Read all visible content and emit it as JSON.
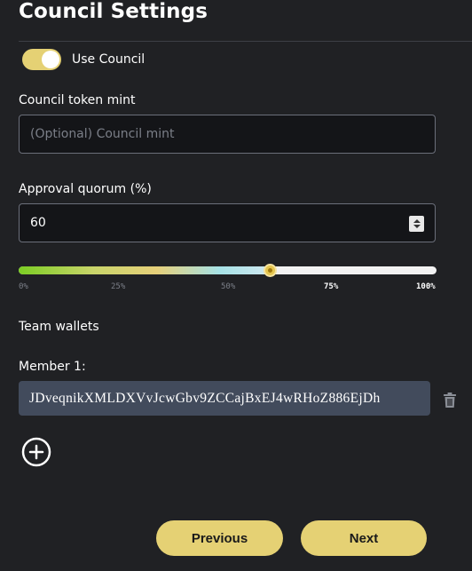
{
  "page": {
    "title": "Council Settings"
  },
  "council_toggle": {
    "label": "Use Council",
    "enabled": true
  },
  "council_mint": {
    "label": "Council token mint",
    "placeholder": "(Optional) Council mint",
    "value": ""
  },
  "approval_quorum": {
    "label": "Approval quorum (%)",
    "value": "60"
  },
  "quorum_slider": {
    "value_percent": 60,
    "ticks": [
      "0%",
      "25%",
      "50%",
      "75%",
      "100%"
    ]
  },
  "team_wallets": {
    "label": "Team wallets",
    "members": [
      {
        "label": "Member 1:",
        "address": "JDveqnikXMLDXVvJcwGbv9ZCCajBxEJ4wRHoZ886EjDh"
      }
    ]
  },
  "nav": {
    "previous_label": "Previous",
    "next_label": "Next"
  },
  "colors": {
    "background": "#202124",
    "accent": "#e5d174",
    "member_field": "#424b5c"
  }
}
